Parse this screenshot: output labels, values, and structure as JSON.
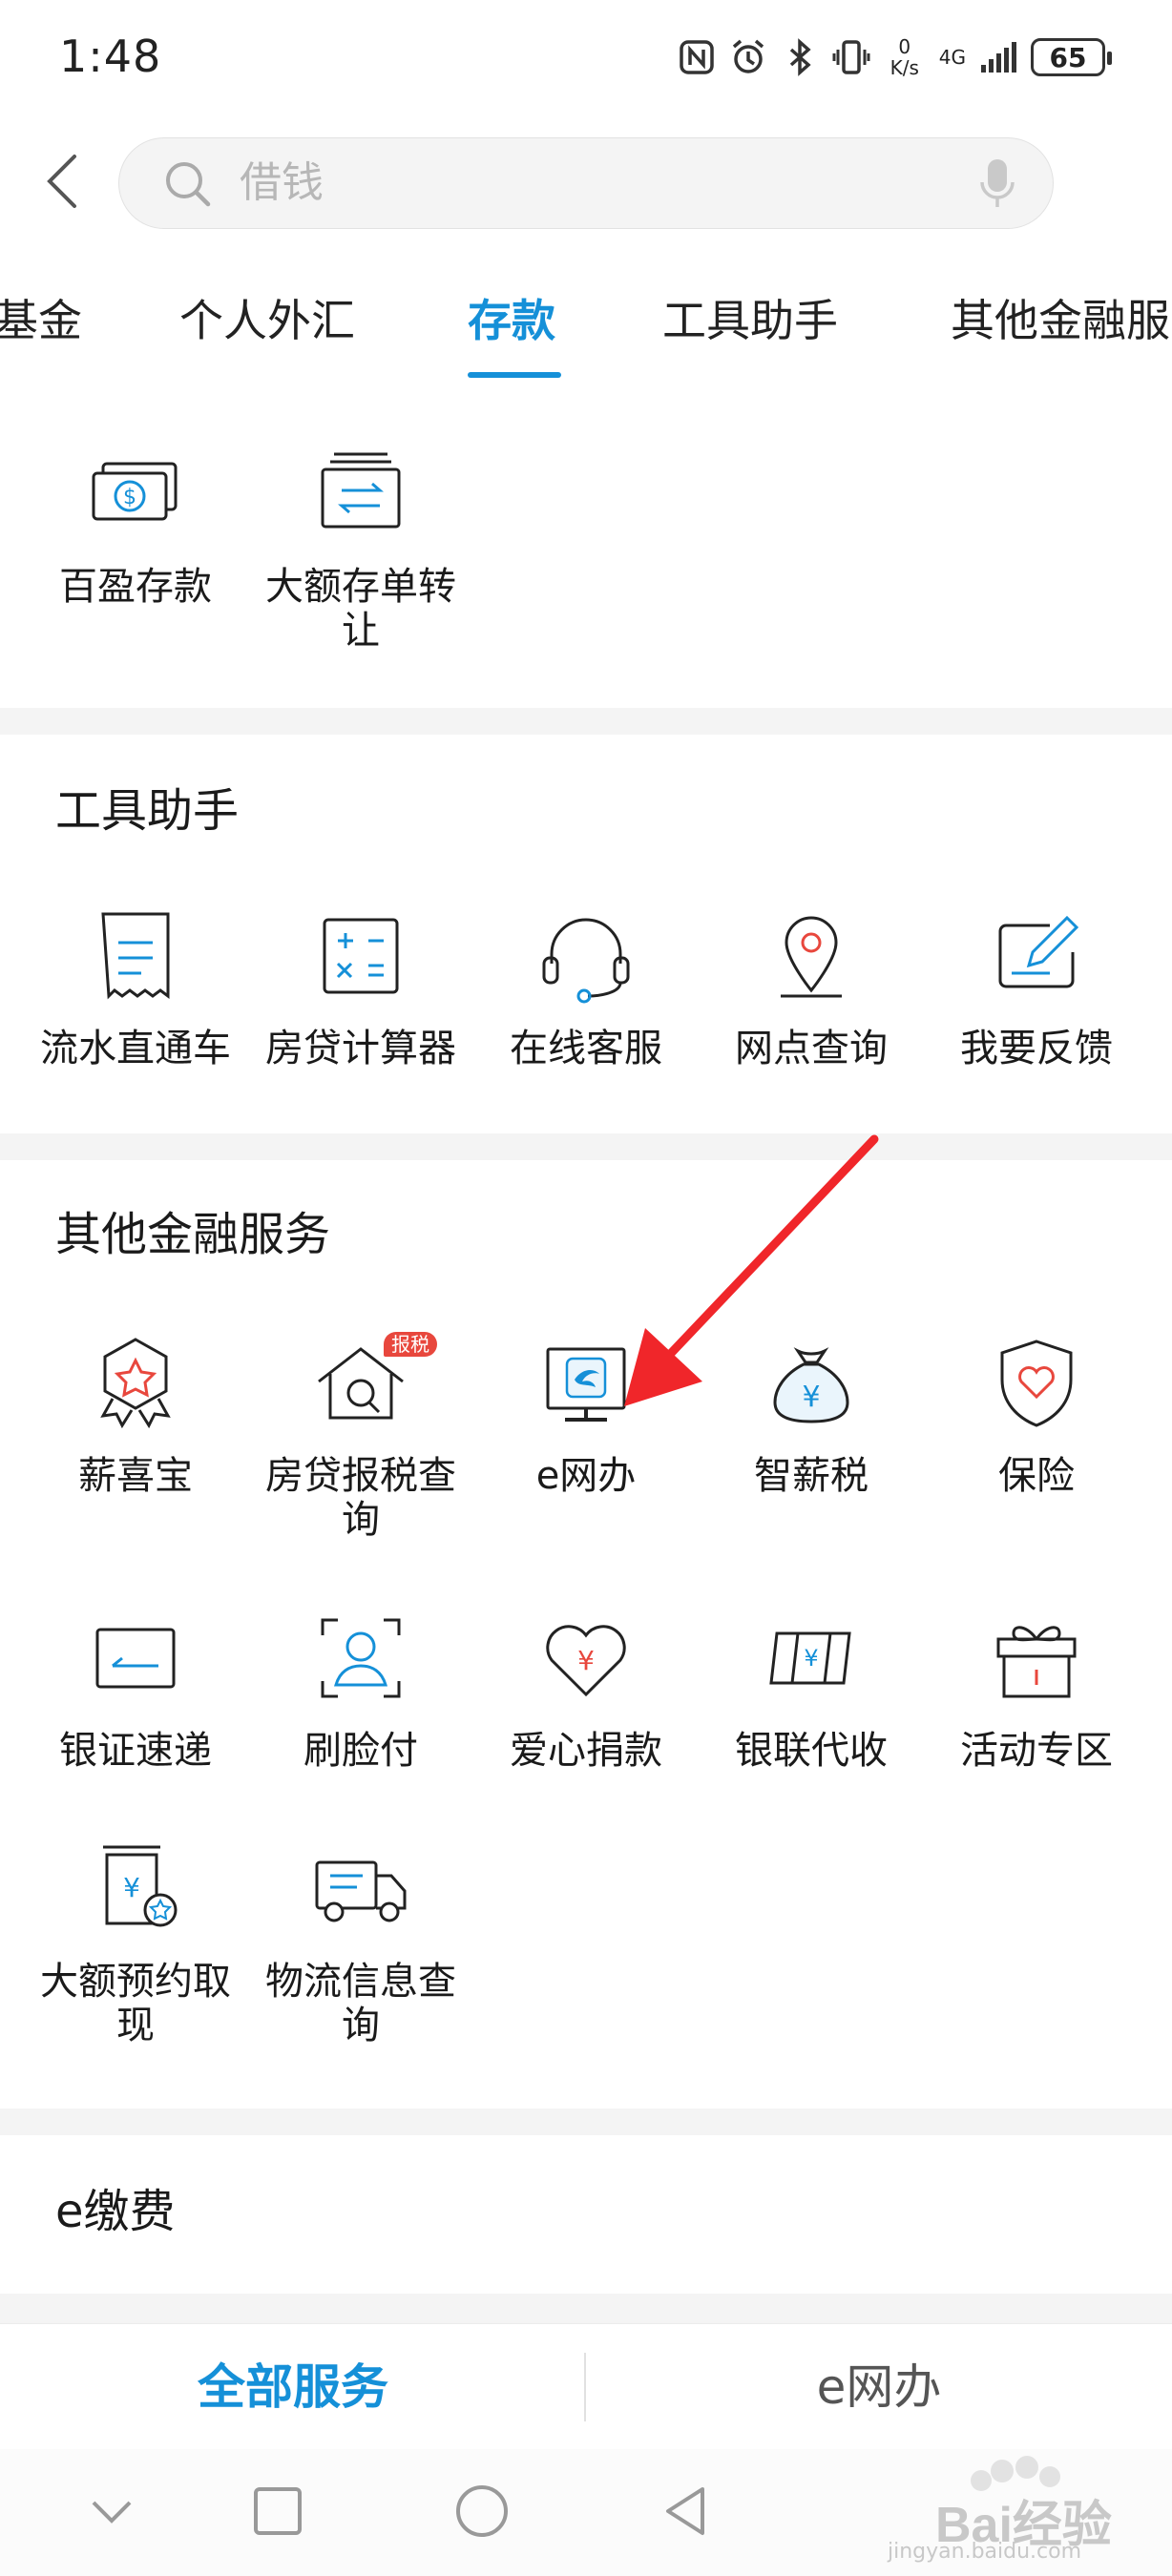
{
  "status_bar": {
    "time": "1:48",
    "net_speed_value": "0",
    "net_speed_unit": "K/s",
    "network": "4G",
    "battery": "65"
  },
  "search": {
    "placeholder": "借钱"
  },
  "tabs": [
    {
      "label": "基金",
      "active": false
    },
    {
      "label": "个人外汇",
      "active": false
    },
    {
      "label": "存款",
      "active": true
    },
    {
      "label": "工具助手",
      "active": false
    },
    {
      "label": "其他金融服",
      "active": false
    }
  ],
  "deposit_section": {
    "items": [
      {
        "label": "百盈存款",
        "icon": "money-icon"
      },
      {
        "label": "大额存单转让",
        "icon": "transfer-document-icon"
      }
    ]
  },
  "tools_section": {
    "title": "工具助手",
    "items": [
      {
        "label": "流水直通车",
        "icon": "receipt-icon"
      },
      {
        "label": "房贷计算器",
        "icon": "calculator-icon"
      },
      {
        "label": "在线客服",
        "icon": "headset-icon"
      },
      {
        "label": "网点查询",
        "icon": "location-pin-icon"
      },
      {
        "label": "我要反馈",
        "icon": "feedback-edit-icon"
      }
    ]
  },
  "other_section": {
    "title": "其他金融服务",
    "badge": "报税",
    "items": [
      {
        "label": "薪喜宝",
        "icon": "badge-star-icon"
      },
      {
        "label": "房贷报税查询",
        "icon": "house-search-icon"
      },
      {
        "label": "e网办",
        "icon": "monitor-icon"
      },
      {
        "label": "智薪税",
        "icon": "money-bag-icon"
      },
      {
        "label": "保险",
        "icon": "shield-heart-icon"
      },
      {
        "label": "银证速递",
        "icon": "card-icon"
      },
      {
        "label": "刷脸付",
        "icon": "face-scan-icon"
      },
      {
        "label": "爱心捐款",
        "icon": "heart-yen-icon"
      },
      {
        "label": "银联代收",
        "icon": "unionpay-card-icon"
      },
      {
        "label": "活动专区",
        "icon": "gift-icon"
      },
      {
        "label": "大额预约取现",
        "icon": "cash-withdraw-icon"
      },
      {
        "label": "物流信息查询",
        "icon": "truck-icon"
      }
    ]
  },
  "pay_section": {
    "title": "e缴费"
  },
  "bottom_nav": {
    "all_services": "全部服务",
    "e_net": "e网办"
  },
  "watermark": {
    "text": "Bai经验",
    "sub": "jingyan.baidu.com"
  },
  "colors": {
    "accent": "#1590d8",
    "arrow": "#f0262a",
    "badge": "#e8473d"
  }
}
